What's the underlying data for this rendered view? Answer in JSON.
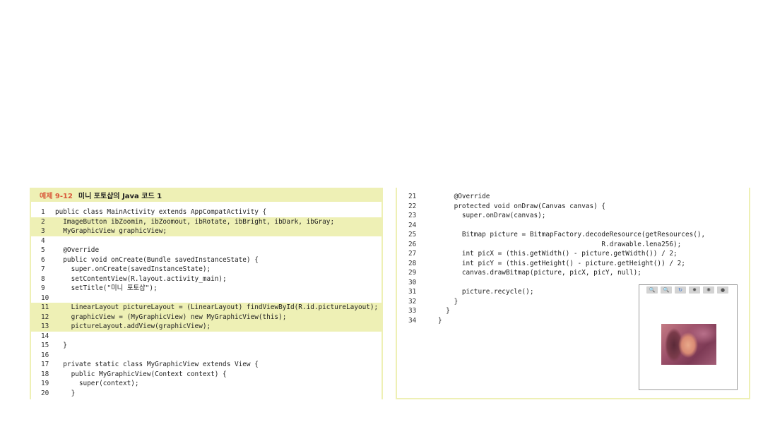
{
  "left": {
    "title_label": "예제 9-12",
    "title_text": "미니 포토샵의 Java 코드 1",
    "lines": [
      {
        "n": "1",
        "t": "public class MainActivity extends AppCompatActivity {",
        "hl": false
      },
      {
        "n": "2",
        "t": "  ImageButton ibZoomin, ibZoomout, ibRotate, ibBright, ibDark, ibGray;",
        "hl": true
      },
      {
        "n": "3",
        "t": "  MyGraphicView graphicView;",
        "hl": true
      },
      {
        "n": "4",
        "t": "",
        "hl": false
      },
      {
        "n": "5",
        "t": "  @Override",
        "hl": false
      },
      {
        "n": "6",
        "t": "  public void onCreate(Bundle savedInstanceState) {",
        "hl": false
      },
      {
        "n": "7",
        "t": "    super.onCreate(savedInstanceState);",
        "hl": false
      },
      {
        "n": "8",
        "t": "    setContentView(R.layout.activity_main);",
        "hl": false
      },
      {
        "n": "9",
        "t": "    setTitle(\"미니 포토샵\");",
        "hl": false
      },
      {
        "n": "10",
        "t": "",
        "hl": false
      },
      {
        "n": "11",
        "t": "    LinearLayout pictureLayout = (LinearLayout) findViewById(R.id.pictureLayout);",
        "hl": true
      },
      {
        "n": "12",
        "t": "    graphicView = (MyGraphicView) new MyGraphicView(this);",
        "hl": true
      },
      {
        "n": "13",
        "t": "    pictureLayout.addView(graphicView);",
        "hl": true
      },
      {
        "n": "14",
        "t": "",
        "hl": false
      },
      {
        "n": "15",
        "t": "  }",
        "hl": false
      },
      {
        "n": "16",
        "t": "",
        "hl": false
      },
      {
        "n": "17",
        "t": "  private static class MyGraphicView extends View {",
        "hl": false
      },
      {
        "n": "18",
        "t": "    public MyGraphicView(Context context) {",
        "hl": false
      },
      {
        "n": "19",
        "t": "      super(context);",
        "hl": false
      },
      {
        "n": "20",
        "t": "    }",
        "hl": false
      }
    ]
  },
  "right": {
    "lines": [
      {
        "n": "21",
        "t": "    @Override",
        "hl": false
      },
      {
        "n": "22",
        "t": "    protected void onDraw(Canvas canvas) {",
        "hl": false
      },
      {
        "n": "23",
        "t": "      super.onDraw(canvas);",
        "hl": false
      },
      {
        "n": "24",
        "t": "",
        "hl": false
      },
      {
        "n": "25",
        "t": "      Bitmap picture = BitmapFactory.decodeResource(getResources(),",
        "hl": false
      },
      {
        "n": "26",
        "t": "                                         R.drawable.lena256);",
        "hl": false
      },
      {
        "n": "27",
        "t": "      int picX = (this.getWidth() - picture.getWidth()) / 2;",
        "hl": false
      },
      {
        "n": "28",
        "t": "      int picY = (this.getHeight() - picture.getHeight()) / 2;",
        "hl": false
      },
      {
        "n": "29",
        "t": "      canvas.drawBitmap(picture, picX, picY, null);",
        "hl": false
      },
      {
        "n": "30",
        "t": "",
        "hl": false
      },
      {
        "n": "31",
        "t": "      picture.recycle();",
        "hl": false
      },
      {
        "n": "32",
        "t": "    }",
        "hl": false
      },
      {
        "n": "33",
        "t": "  }",
        "hl": false
      },
      {
        "n": "34",
        "t": "}",
        "hl": false
      }
    ]
  },
  "preview": {
    "toolbar_icons": [
      "zoom-in-icon",
      "zoom-out-icon",
      "rotate-icon",
      "bright-icon",
      "dark-icon",
      "gray-icon"
    ],
    "image_name": "lena-image"
  },
  "colors": {
    "highlight": "#eef0b5",
    "title_accent": "#d9573a"
  }
}
